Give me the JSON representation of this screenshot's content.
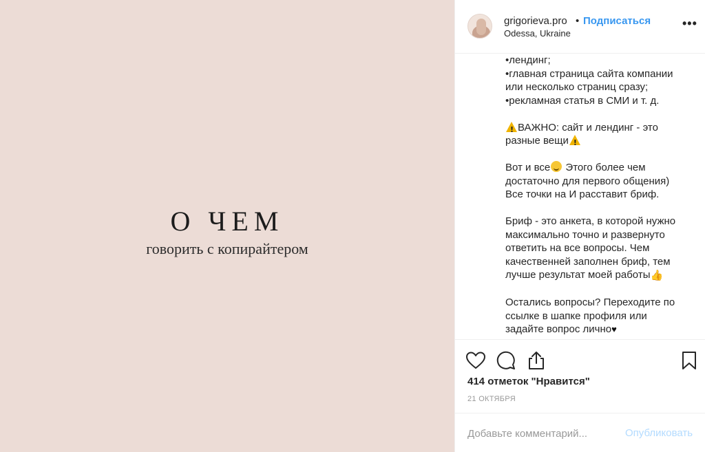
{
  "post": {
    "title": "О ЧЕМ",
    "subtitle": "говорить с копирайтером",
    "background": "#ecdcd6"
  },
  "header": {
    "username": "grigorieva.pro",
    "separator": "•",
    "follow_label": "Подписаться",
    "location": "Odessa, Ukraine",
    "more_icon": "more-horizontal-icon",
    "more_label": "•••"
  },
  "caption": {
    "p1": [
      "•лендинг;",
      "•главная страница сайта компании",
      "или несколько страниц сразу;",
      "•рекламная статья в СМИ и т. д."
    ],
    "p2": {
      "a": "ВАЖНО: сайт и лендинг - это",
      "b": "разные вещи"
    },
    "p3": {
      "a": "Вот и все",
      "b": " Этого более чем",
      "c": "достаточно для первого общения)",
      "d": "Все точки на И расставит бриф."
    },
    "p4": {
      "a": "Бриф - это анкета, в которой нужно",
      "b": "максимально точно и развернуто",
      "c": "ответить на все вопросы. Чем",
      "d": "качественней заполнен бриф, тем",
      "e": "лучше результат моей работы"
    },
    "p5": {
      "a": "Остались вопросы? Переходите по",
      "b": "ссылке в шапке профиля или",
      "c": "задайте вопрос лично"
    },
    "thumb_emoji": "👍",
    "heart_emoji": "♥"
  },
  "actions": {
    "likes": "414 отметок \"Нравится\"",
    "date": "21 ОКТЯБРЯ",
    "icons": [
      "heart-icon",
      "comment-icon",
      "share-icon",
      "bookmark-icon"
    ]
  },
  "comment": {
    "placeholder": "Добавьте комментарий...",
    "publish_label": "Опубликовать"
  },
  "colors": {
    "accent": "#3897f0",
    "publish_disabled": "#b3dbff",
    "muted": "#999999"
  }
}
